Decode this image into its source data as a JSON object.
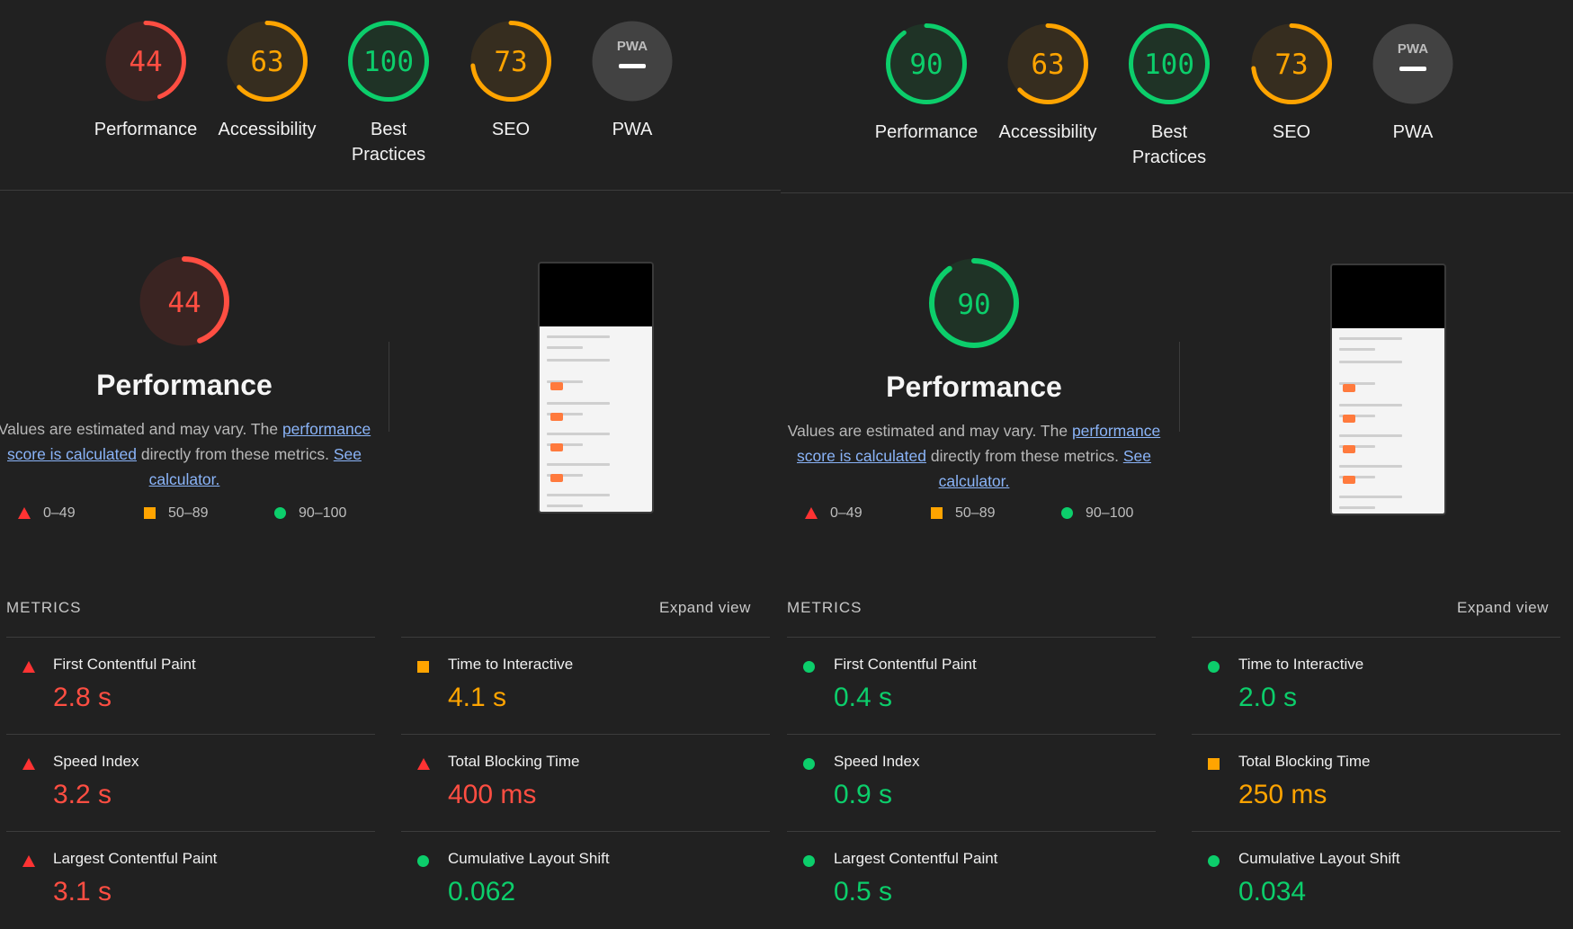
{
  "colors": {
    "fail": "#ff4e42",
    "average": "#ffa400",
    "pass": "#0cce6b",
    "background": "#212121"
  },
  "reports": [
    {
      "gauges": [
        {
          "label": "Performance",
          "score": "44",
          "status": "fail"
        },
        {
          "label": "Accessibility",
          "score": "63",
          "status": "average"
        },
        {
          "label": "Best Practices",
          "score": "100",
          "status": "pass"
        },
        {
          "label": "SEO",
          "score": "73",
          "status": "average"
        },
        {
          "label": "PWA",
          "score": "",
          "status": "pwa"
        }
      ],
      "performance": {
        "score": "44",
        "status": "fail",
        "title": "Performance",
        "desc_prefix": "Values are estimated and may vary. The ",
        "desc_link1": "performance score is calculated",
        "desc_mid": " directly from these metrics. ",
        "desc_link2": "See calculator."
      },
      "legend": [
        "0–49",
        "50–89",
        "90–100"
      ],
      "metrics_heading": "METRICS",
      "expand_label": "Expand view",
      "metrics": [
        {
          "name": "First Contentful Paint",
          "value": "2.8 s",
          "status": "fail"
        },
        {
          "name": "Time to Interactive",
          "value": "4.1 s",
          "status": "average"
        },
        {
          "name": "Speed Index",
          "value": "3.2 s",
          "status": "fail"
        },
        {
          "name": "Total Blocking Time",
          "value": "400 ms",
          "status": "fail"
        },
        {
          "name": "Largest Contentful Paint",
          "value": "3.1 s",
          "status": "fail"
        },
        {
          "name": "Cumulative Layout Shift",
          "value": "0.062",
          "status": "pass"
        }
      ]
    },
    {
      "gauges": [
        {
          "label": "Performance",
          "score": "90",
          "status": "pass"
        },
        {
          "label": "Accessibility",
          "score": "63",
          "status": "average"
        },
        {
          "label": "Best Practices",
          "score": "100",
          "status": "pass"
        },
        {
          "label": "SEO",
          "score": "73",
          "status": "average"
        },
        {
          "label": "PWA",
          "score": "",
          "status": "pwa"
        }
      ],
      "performance": {
        "score": "90",
        "status": "pass",
        "title": "Performance",
        "desc_prefix": "Values are estimated and may vary. The ",
        "desc_link1": "performance score is calculated",
        "desc_mid": " directly from these metrics. ",
        "desc_link2": "See calculator."
      },
      "legend": [
        "0–49",
        "50–89",
        "90–100"
      ],
      "metrics_heading": "METRICS",
      "expand_label": "Expand view",
      "metrics": [
        {
          "name": "First Contentful Paint",
          "value": "0.4 s",
          "status": "pass"
        },
        {
          "name": "Time to Interactive",
          "value": "2.0 s",
          "status": "pass"
        },
        {
          "name": "Speed Index",
          "value": "0.9 s",
          "status": "pass"
        },
        {
          "name": "Total Blocking Time",
          "value": "250 ms",
          "status": "average"
        },
        {
          "name": "Largest Contentful Paint",
          "value": "0.5 s",
          "status": "pass"
        },
        {
          "name": "Cumulative Layout Shift",
          "value": "0.034",
          "status": "pass"
        }
      ]
    }
  ],
  "pwa_badge": "PWA"
}
